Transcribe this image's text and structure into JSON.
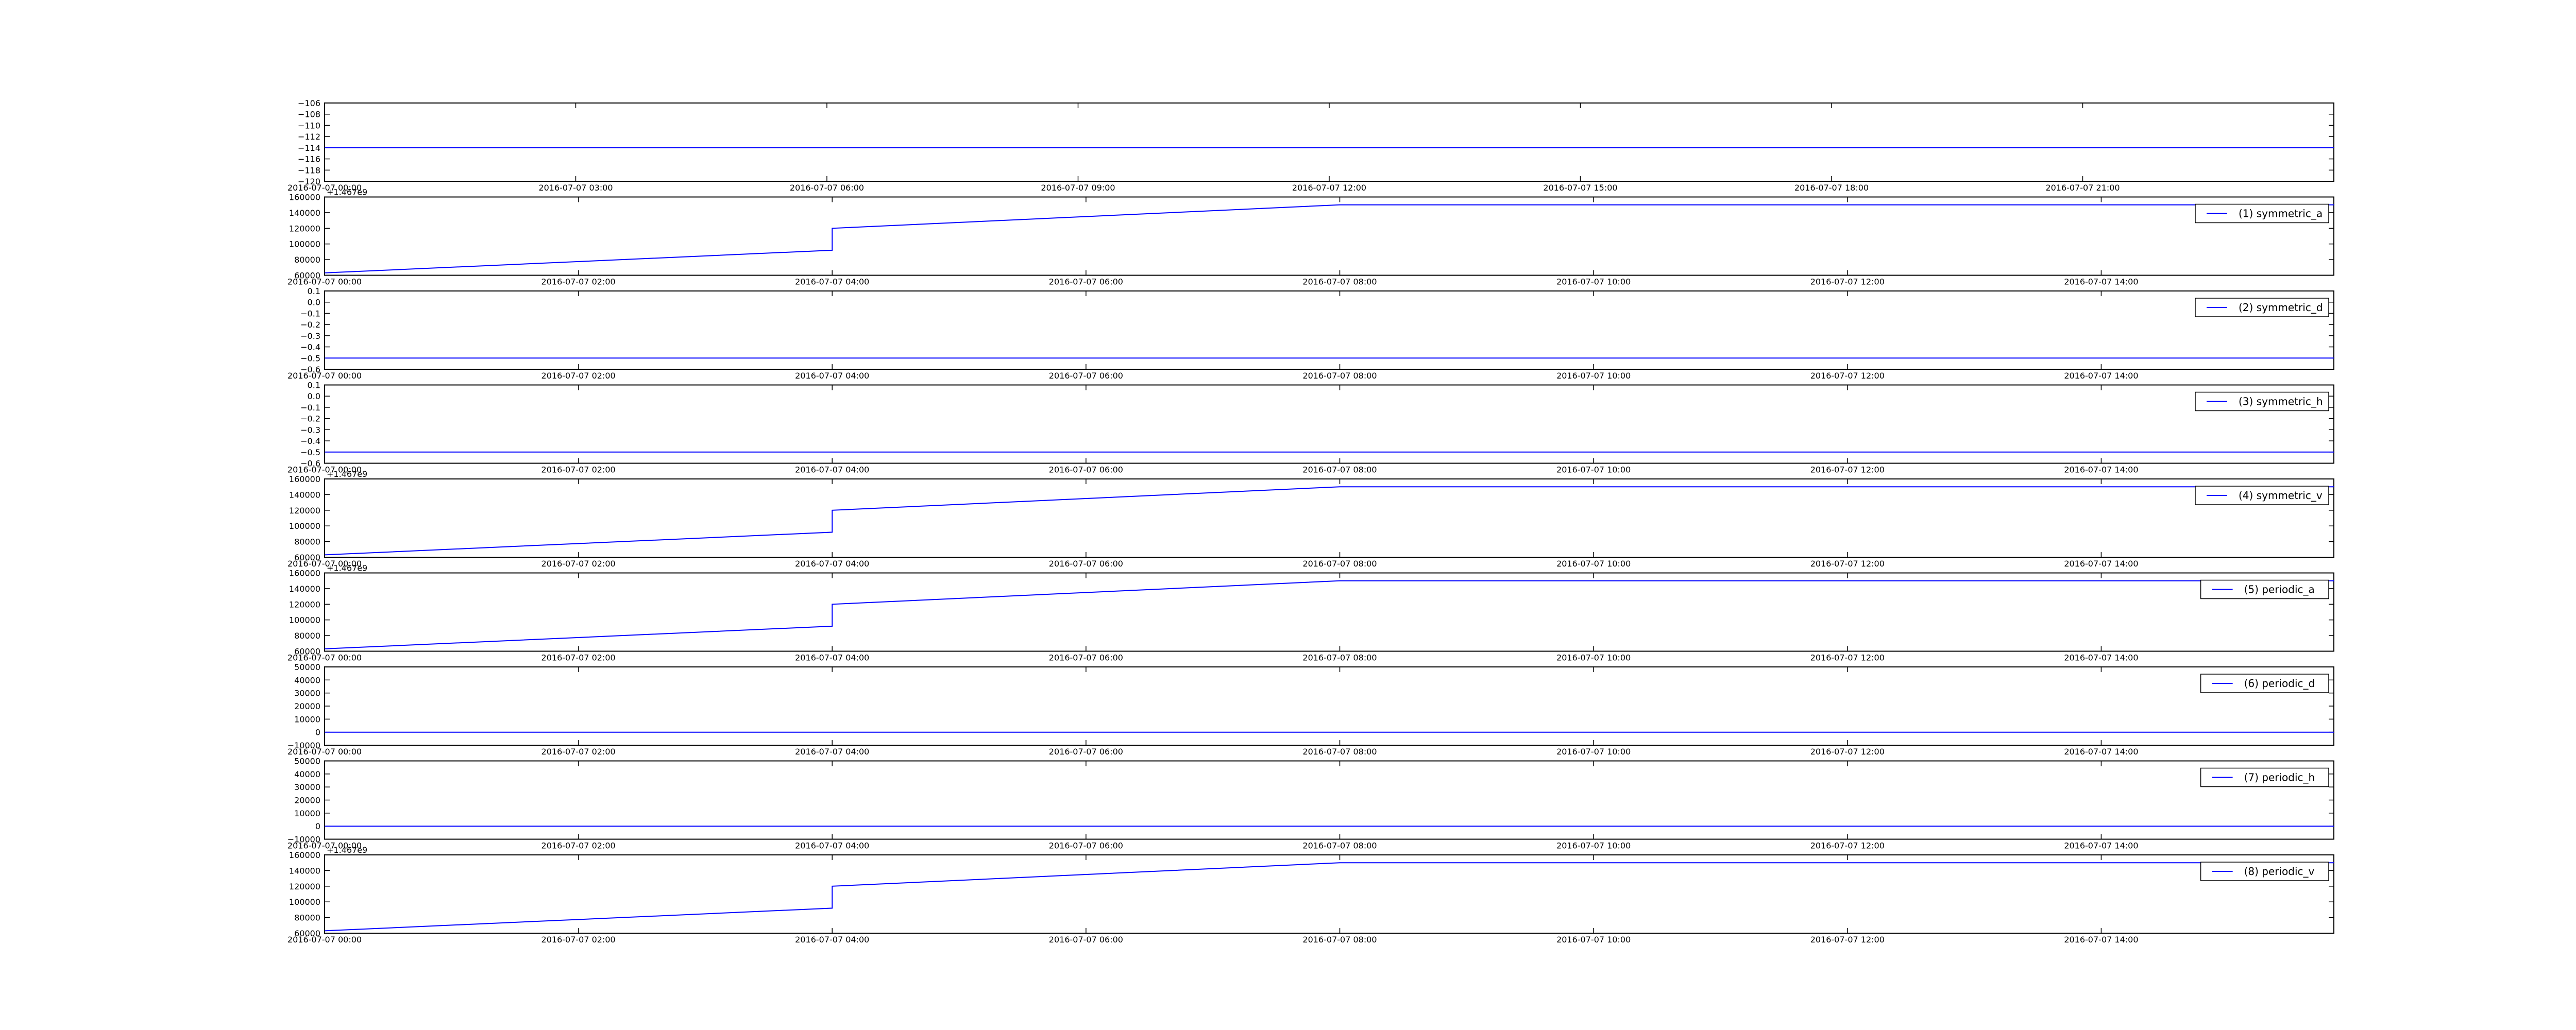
{
  "figure": {
    "background": "#ffffff",
    "axes_color": "#000000",
    "series_color": "#0000ff"
  },
  "chart_data": [
    {
      "type": "line",
      "title": "",
      "xlabel": "",
      "ylabel": "",
      "legend": null,
      "y_offset_label": "",
      "ylim": [
        -120,
        -106
      ],
      "yticks": [
        -120,
        -118,
        -116,
        -114,
        -112,
        -110,
        -108,
        -106
      ],
      "ytick_labels": [
        "−120",
        "−118",
        "−116",
        "−114",
        "−112",
        "−110",
        "−108",
        "−106"
      ],
      "xlim": [
        "2016-07-07 00:00",
        "2016-07-08 00:00"
      ],
      "xtick_labels": [
        "2016-07-07 00:00",
        "2016-07-07 03:00",
        "2016-07-07 06:00",
        "2016-07-07 09:00",
        "2016-07-07 12:00",
        "2016-07-07 15:00",
        "2016-07-07 18:00",
        "2016-07-07 21:00"
      ],
      "series": [
        {
          "x": [
            "2016-07-07 00:00",
            "2016-07-08 00:00"
          ],
          "y": [
            -114,
            -114
          ]
        }
      ]
    },
    {
      "type": "line",
      "legend": "(1) symmetric_a",
      "legend_location": "upper-right",
      "y_offset_label": "+1.467e9",
      "ylim": [
        60000,
        160000
      ],
      "yticks": [
        60000,
        80000,
        100000,
        120000,
        140000,
        160000
      ],
      "ytick_labels": [
        "60000",
        "80000",
        "100000",
        "120000",
        "140000",
        "160000"
      ],
      "xlim": [
        "2016-07-07 00:00",
        "2016-07-07 15:50"
      ],
      "xtick_labels": [
        "2016-07-07 00:00",
        "2016-07-07 02:00",
        "2016-07-07 04:00",
        "2016-07-07 06:00",
        "2016-07-07 08:00",
        "2016-07-07 10:00",
        "2016-07-07 12:00",
        "2016-07-07 14:00"
      ],
      "series": [
        {
          "name": "(1) symmetric_a",
          "x": [
            "2016-07-07 00:00",
            "2016-07-07 04:00",
            "2016-07-07 04:00",
            "2016-07-07 08:00",
            "2016-07-07 15:50"
          ],
          "y": [
            63000,
            92000,
            120000,
            150000,
            150000
          ]
        }
      ]
    },
    {
      "type": "line",
      "legend": "(2) symmetric_d",
      "legend_location": "upper-right",
      "y_offset_label": "",
      "ylim": [
        -0.6,
        0.1
      ],
      "yticks": [
        -0.6,
        -0.5,
        -0.4,
        -0.3,
        -0.2,
        -0.1,
        0.0,
        0.1
      ],
      "ytick_labels": [
        "−0.6",
        "−0.5",
        "−0.4",
        "−0.3",
        "−0.2",
        "−0.1",
        "0.0",
        "0.1"
      ],
      "xlim": [
        "2016-07-07 00:00",
        "2016-07-07 15:50"
      ],
      "xtick_labels": [
        "2016-07-07 00:00",
        "2016-07-07 02:00",
        "2016-07-07 04:00",
        "2016-07-07 06:00",
        "2016-07-07 08:00",
        "2016-07-07 10:00",
        "2016-07-07 12:00",
        "2016-07-07 14:00"
      ],
      "series": [
        {
          "name": "(2) symmetric_d",
          "x": [
            "2016-07-07 00:00",
            "2016-07-07 15:50"
          ],
          "y": [
            -0.5,
            -0.5
          ]
        }
      ]
    },
    {
      "type": "line",
      "legend": "(3) symmetric_h",
      "legend_location": "upper-right",
      "y_offset_label": "",
      "ylim": [
        -0.6,
        0.1
      ],
      "yticks": [
        -0.6,
        -0.5,
        -0.4,
        -0.3,
        -0.2,
        -0.1,
        0.0,
        0.1
      ],
      "ytick_labels": [
        "−0.6",
        "−0.5",
        "−0.4",
        "−0.3",
        "−0.2",
        "−0.1",
        "0.0",
        "0.1"
      ],
      "xlim": [
        "2016-07-07 00:00",
        "2016-07-07 15:50"
      ],
      "xtick_labels": [
        "2016-07-07 00:00",
        "2016-07-07 02:00",
        "2016-07-07 04:00",
        "2016-07-07 06:00",
        "2016-07-07 08:00",
        "2016-07-07 10:00",
        "2016-07-07 12:00",
        "2016-07-07 14:00"
      ],
      "series": [
        {
          "name": "(3) symmetric_h",
          "x": [
            "2016-07-07 00:00",
            "2016-07-07 15:50"
          ],
          "y": [
            -0.5,
            -0.5
          ]
        }
      ]
    },
    {
      "type": "line",
      "legend": "(4) symmetric_v",
      "legend_location": "upper-right",
      "y_offset_label": "+1.467e9",
      "ylim": [
        60000,
        160000
      ],
      "yticks": [
        60000,
        80000,
        100000,
        120000,
        140000,
        160000
      ],
      "ytick_labels": [
        "60000",
        "80000",
        "100000",
        "120000",
        "140000",
        "160000"
      ],
      "xlim": [
        "2016-07-07 00:00",
        "2016-07-07 15:50"
      ],
      "xtick_labels": [
        "2016-07-07 00:00",
        "2016-07-07 02:00",
        "2016-07-07 04:00",
        "2016-07-07 06:00",
        "2016-07-07 08:00",
        "2016-07-07 10:00",
        "2016-07-07 12:00",
        "2016-07-07 14:00"
      ],
      "series": [
        {
          "name": "(4) symmetric_v",
          "x": [
            "2016-07-07 00:00",
            "2016-07-07 04:00",
            "2016-07-07 04:00",
            "2016-07-07 08:00",
            "2016-07-07 15:50"
          ],
          "y": [
            63000,
            92000,
            120000,
            150000,
            150000
          ]
        }
      ]
    },
    {
      "type": "line",
      "legend": "(5) periodic_a",
      "legend_location": "upper-right",
      "y_offset_label": "+1.467e9",
      "ylim": [
        60000,
        160000
      ],
      "yticks": [
        60000,
        80000,
        100000,
        120000,
        140000,
        160000
      ],
      "ytick_labels": [
        "60000",
        "80000",
        "100000",
        "120000",
        "140000",
        "160000"
      ],
      "xlim": [
        "2016-07-07 00:00",
        "2016-07-07 15:50"
      ],
      "xtick_labels": [
        "2016-07-07 00:00",
        "2016-07-07 02:00",
        "2016-07-07 04:00",
        "2016-07-07 06:00",
        "2016-07-07 08:00",
        "2016-07-07 10:00",
        "2016-07-07 12:00",
        "2016-07-07 14:00"
      ],
      "series": [
        {
          "name": "(5) periodic_a",
          "x": [
            "2016-07-07 00:00",
            "2016-07-07 04:00",
            "2016-07-07 04:00",
            "2016-07-07 08:00",
            "2016-07-07 15:50"
          ],
          "y": [
            63000,
            92000,
            120000,
            150000,
            150000
          ]
        }
      ]
    },
    {
      "type": "line",
      "legend": "(6) periodic_d",
      "legend_location": "upper-right",
      "y_offset_label": "",
      "ylim": [
        -10000,
        50000
      ],
      "yticks": [
        -10000,
        0,
        10000,
        20000,
        30000,
        40000,
        50000
      ],
      "ytick_labels": [
        "−10000",
        "0",
        "10000",
        "20000",
        "30000",
        "40000",
        "50000"
      ],
      "xlim": [
        "2016-07-07 00:00",
        "2016-07-07 15:50"
      ],
      "xtick_labels": [
        "2016-07-07 00:00",
        "2016-07-07 02:00",
        "2016-07-07 04:00",
        "2016-07-07 06:00",
        "2016-07-07 08:00",
        "2016-07-07 10:00",
        "2016-07-07 12:00",
        "2016-07-07 14:00"
      ],
      "series": [
        {
          "name": "(6) periodic_d",
          "x": [
            "2016-07-07 00:00",
            "2016-07-07 15:50"
          ],
          "y": [
            0,
            0
          ]
        }
      ]
    },
    {
      "type": "line",
      "legend": "(7) periodic_h",
      "legend_location": "upper-right",
      "y_offset_label": "",
      "ylim": [
        -10000,
        50000
      ],
      "yticks": [
        -10000,
        0,
        10000,
        20000,
        30000,
        40000,
        50000
      ],
      "ytick_labels": [
        "−10000",
        "0",
        "10000",
        "20000",
        "30000",
        "40000",
        "50000"
      ],
      "xlim": [
        "2016-07-07 00:00",
        "2016-07-07 15:50"
      ],
      "xtick_labels": [
        "2016-07-07 00:00",
        "2016-07-07 02:00",
        "2016-07-07 04:00",
        "2016-07-07 06:00",
        "2016-07-07 08:00",
        "2016-07-07 10:00",
        "2016-07-07 12:00",
        "2016-07-07 14:00"
      ],
      "series": [
        {
          "name": "(7) periodic_h",
          "x": [
            "2016-07-07 00:00",
            "2016-07-07 15:50"
          ],
          "y": [
            0,
            0
          ]
        }
      ]
    },
    {
      "type": "line",
      "legend": "(8) periodic_v",
      "legend_location": "upper-right",
      "y_offset_label": "+1.467e9",
      "ylim": [
        60000,
        160000
      ],
      "yticks": [
        60000,
        80000,
        100000,
        120000,
        140000,
        160000
      ],
      "ytick_labels": [
        "60000",
        "80000",
        "100000",
        "120000",
        "140000",
        "160000"
      ],
      "xlim": [
        "2016-07-07 00:00",
        "2016-07-07 15:50"
      ],
      "xtick_labels": [
        "2016-07-07 00:00",
        "2016-07-07 02:00",
        "2016-07-07 04:00",
        "2016-07-07 06:00",
        "2016-07-07 08:00",
        "2016-07-07 10:00",
        "2016-07-07 12:00",
        "2016-07-07 14:00"
      ],
      "series": [
        {
          "name": "(8) periodic_v",
          "x": [
            "2016-07-07 00:00",
            "2016-07-07 04:00",
            "2016-07-07 04:00",
            "2016-07-07 08:00",
            "2016-07-07 15:50"
          ],
          "y": [
            63000,
            92000,
            120000,
            150000,
            150000
          ]
        }
      ]
    }
  ]
}
